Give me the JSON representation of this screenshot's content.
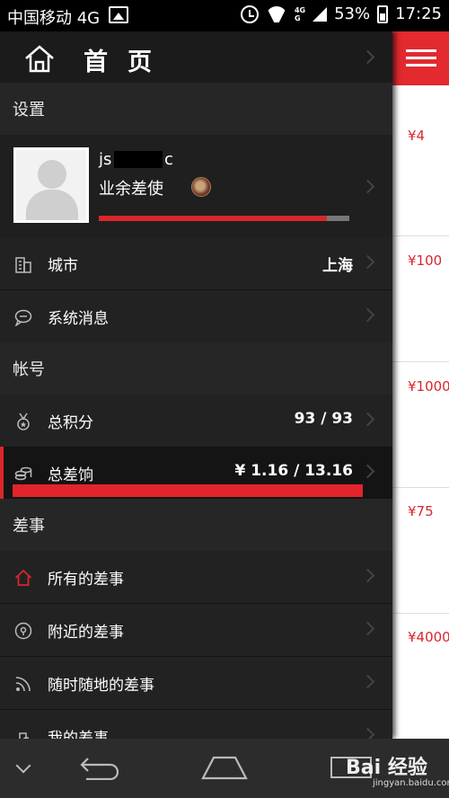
{
  "status_bar": {
    "carrier": "中国移动 4G",
    "network": "4G",
    "battery": "53%",
    "time": "17:25"
  },
  "header": {
    "title": "首页"
  },
  "sections": {
    "settings": "设置",
    "account": "帐号",
    "errands": "差事"
  },
  "profile": {
    "username_start": "js",
    "username_end": "c",
    "level": "业余差使",
    "progress": 0.91
  },
  "settings_items": [
    {
      "label": "城市",
      "value": "上海",
      "icon": "building-icon"
    },
    {
      "label": "系统消息",
      "value": "",
      "icon": "chat-bubble-icon"
    }
  ],
  "account_items": [
    {
      "label": "总积分",
      "value": "93 / 93",
      "icon": "medal-icon"
    },
    {
      "label": "总差饷",
      "value": "¥ 1.16 / 13.16",
      "icon": "coins-icon"
    }
  ],
  "errand_items": [
    {
      "label": "所有的差事",
      "icon": "home-outline-icon"
    },
    {
      "label": "附近的差事",
      "icon": "location-pin-icon"
    },
    {
      "label": "随时随地的差事",
      "icon": "rss-icon"
    },
    {
      "label": "我的差事",
      "icon": "hand-icon"
    }
  ],
  "peek_prices": [
    "¥4",
    "¥100",
    "¥1000",
    "¥75",
    "¥4000"
  ],
  "watermark": {
    "main": "Bai 经验",
    "sub": "jingyan.baidu.com"
  },
  "colors": {
    "accent": "#e22a2f",
    "drawer_bg": "#1f1f1f",
    "section_bg": "#262626"
  }
}
